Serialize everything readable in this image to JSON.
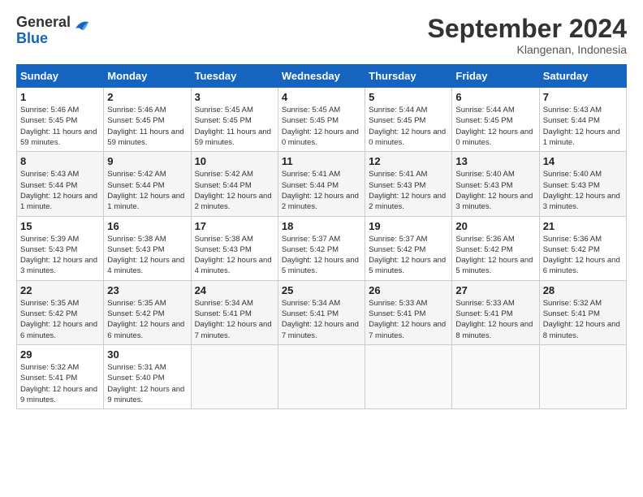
{
  "header": {
    "logo_general": "General",
    "logo_blue": "Blue",
    "month_title": "September 2024",
    "location": "Klangenan, Indonesia"
  },
  "days_of_week": [
    "Sunday",
    "Monday",
    "Tuesday",
    "Wednesday",
    "Thursday",
    "Friday",
    "Saturday"
  ],
  "weeks": [
    [
      {
        "day": "1",
        "sunrise": "5:46 AM",
        "sunset": "5:45 PM",
        "daylight": "11 hours and 59 minutes."
      },
      {
        "day": "2",
        "sunrise": "5:46 AM",
        "sunset": "5:45 PM",
        "daylight": "11 hours and 59 minutes."
      },
      {
        "day": "3",
        "sunrise": "5:45 AM",
        "sunset": "5:45 PM",
        "daylight": "11 hours and 59 minutes."
      },
      {
        "day": "4",
        "sunrise": "5:45 AM",
        "sunset": "5:45 PM",
        "daylight": "12 hours and 0 minutes."
      },
      {
        "day": "5",
        "sunrise": "5:44 AM",
        "sunset": "5:45 PM",
        "daylight": "12 hours and 0 minutes."
      },
      {
        "day": "6",
        "sunrise": "5:44 AM",
        "sunset": "5:45 PM",
        "daylight": "12 hours and 0 minutes."
      },
      {
        "day": "7",
        "sunrise": "5:43 AM",
        "sunset": "5:44 PM",
        "daylight": "12 hours and 1 minute."
      }
    ],
    [
      {
        "day": "8",
        "sunrise": "5:43 AM",
        "sunset": "5:44 PM",
        "daylight": "12 hours and 1 minute."
      },
      {
        "day": "9",
        "sunrise": "5:42 AM",
        "sunset": "5:44 PM",
        "daylight": "12 hours and 1 minute."
      },
      {
        "day": "10",
        "sunrise": "5:42 AM",
        "sunset": "5:44 PM",
        "daylight": "12 hours and 2 minutes."
      },
      {
        "day": "11",
        "sunrise": "5:41 AM",
        "sunset": "5:44 PM",
        "daylight": "12 hours and 2 minutes."
      },
      {
        "day": "12",
        "sunrise": "5:41 AM",
        "sunset": "5:43 PM",
        "daylight": "12 hours and 2 minutes."
      },
      {
        "day": "13",
        "sunrise": "5:40 AM",
        "sunset": "5:43 PM",
        "daylight": "12 hours and 3 minutes."
      },
      {
        "day": "14",
        "sunrise": "5:40 AM",
        "sunset": "5:43 PM",
        "daylight": "12 hours and 3 minutes."
      }
    ],
    [
      {
        "day": "15",
        "sunrise": "5:39 AM",
        "sunset": "5:43 PM",
        "daylight": "12 hours and 3 minutes."
      },
      {
        "day": "16",
        "sunrise": "5:38 AM",
        "sunset": "5:43 PM",
        "daylight": "12 hours and 4 minutes."
      },
      {
        "day": "17",
        "sunrise": "5:38 AM",
        "sunset": "5:43 PM",
        "daylight": "12 hours and 4 minutes."
      },
      {
        "day": "18",
        "sunrise": "5:37 AM",
        "sunset": "5:42 PM",
        "daylight": "12 hours and 5 minutes."
      },
      {
        "day": "19",
        "sunrise": "5:37 AM",
        "sunset": "5:42 PM",
        "daylight": "12 hours and 5 minutes."
      },
      {
        "day": "20",
        "sunrise": "5:36 AM",
        "sunset": "5:42 PM",
        "daylight": "12 hours and 5 minutes."
      },
      {
        "day": "21",
        "sunrise": "5:36 AM",
        "sunset": "5:42 PM",
        "daylight": "12 hours and 6 minutes."
      }
    ],
    [
      {
        "day": "22",
        "sunrise": "5:35 AM",
        "sunset": "5:42 PM",
        "daylight": "12 hours and 6 minutes."
      },
      {
        "day": "23",
        "sunrise": "5:35 AM",
        "sunset": "5:42 PM",
        "daylight": "12 hours and 6 minutes."
      },
      {
        "day": "24",
        "sunrise": "5:34 AM",
        "sunset": "5:41 PM",
        "daylight": "12 hours and 7 minutes."
      },
      {
        "day": "25",
        "sunrise": "5:34 AM",
        "sunset": "5:41 PM",
        "daylight": "12 hours and 7 minutes."
      },
      {
        "day": "26",
        "sunrise": "5:33 AM",
        "sunset": "5:41 PM",
        "daylight": "12 hours and 7 minutes."
      },
      {
        "day": "27",
        "sunrise": "5:33 AM",
        "sunset": "5:41 PM",
        "daylight": "12 hours and 8 minutes."
      },
      {
        "day": "28",
        "sunrise": "5:32 AM",
        "sunset": "5:41 PM",
        "daylight": "12 hours and 8 minutes."
      }
    ],
    [
      {
        "day": "29",
        "sunrise": "5:32 AM",
        "sunset": "5:41 PM",
        "daylight": "12 hours and 9 minutes."
      },
      {
        "day": "30",
        "sunrise": "5:31 AM",
        "sunset": "5:40 PM",
        "daylight": "12 hours and 9 minutes."
      },
      null,
      null,
      null,
      null,
      null
    ]
  ],
  "labels": {
    "sunrise": "Sunrise:",
    "sunset": "Sunset:",
    "daylight": "Daylight:"
  }
}
